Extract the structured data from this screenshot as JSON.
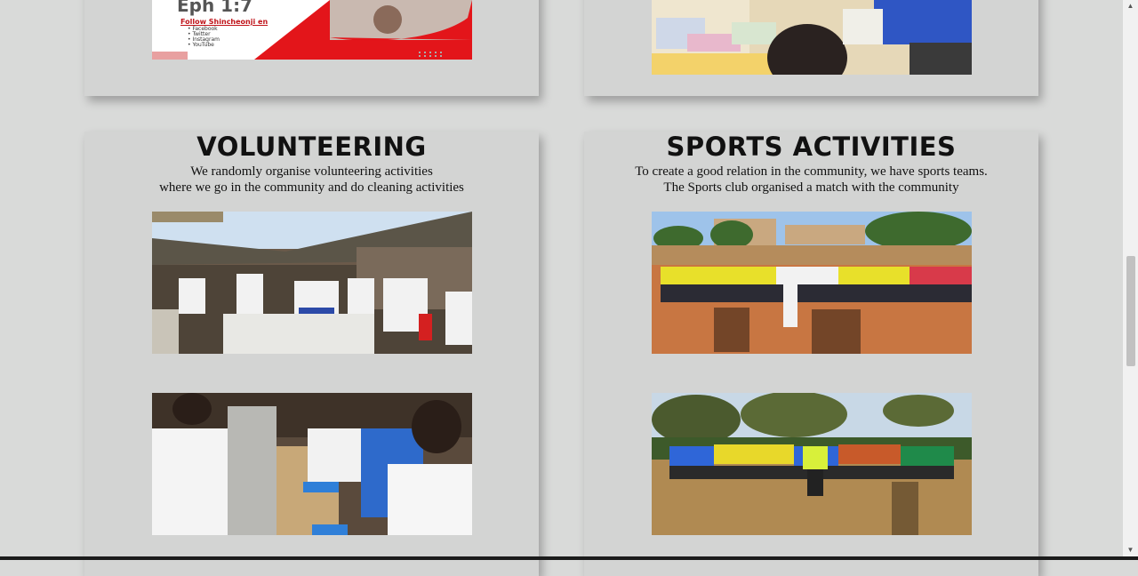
{
  "top_left_card": {
    "verse": "Eph 1:7",
    "follow_label": "Follow Shincheonji en",
    "social_links": [
      "Facebook",
      "Twitter",
      "Instagram",
      "YouTube"
    ]
  },
  "volunteering": {
    "title": "VOLUNTEERING",
    "desc_line1": "We randomly organise volunteering activities",
    "desc_line2": "where we go in the community and do cleaning activities"
  },
  "sports": {
    "title": "SPORTS ACTIVITIES",
    "desc_line1": "To create a good relation in the community, we have sports teams.",
    "desc_line2": "The Sports club organised a match with the community"
  },
  "colors": {
    "page_bg": "#d9dad9",
    "card_bg": "#d3d4d3",
    "accent_red": "#e3151a"
  }
}
